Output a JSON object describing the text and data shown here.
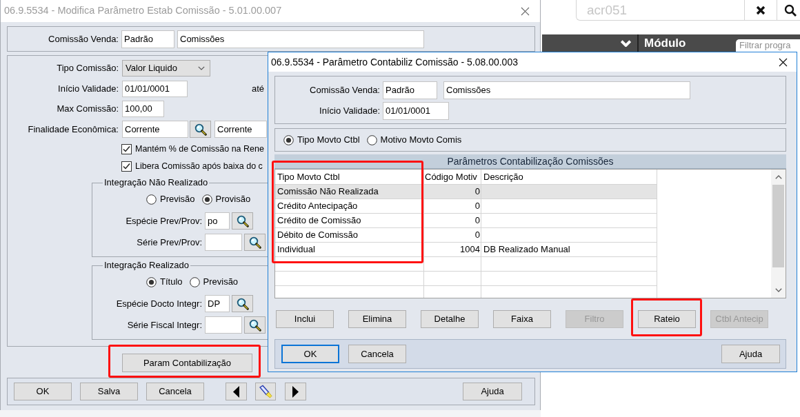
{
  "main_dialog": {
    "title": "06.9.5534 - Modifica Parâmetro Estab Comissão - 5.01.00.007",
    "active": false,
    "commission": {
      "label": "Comissão Venda:",
      "code": "Padrão",
      "name": "Comissões"
    },
    "commission_type": {
      "label": "Tipo Comissão:",
      "value": "Valor Liquido"
    },
    "valid_from": {
      "label": "Início Validade:",
      "value": "01/01/0001",
      "until_label": "até"
    },
    "max_commission": {
      "label": "Max Comissão:",
      "value": "100,00"
    },
    "economic_purpose": {
      "label": "Finalidade Econômica:",
      "code": "Corrente",
      "description": "Corrente"
    },
    "checkboxes": [
      {
        "label": "Mantém % de Comissão na Rene",
        "checked": true
      },
      {
        "label": "Libera Comissão após baixa do c",
        "checked": true
      }
    ],
    "groups": [
      {
        "title": "Integração Não Realizado",
        "options": [
          {
            "label": "Previsão",
            "selected": false
          },
          {
            "label": "Provisão",
            "selected": true
          }
        ],
        "fields": [
          {
            "label": "Espécie Prev/Prov:",
            "value": "po"
          },
          {
            "label": "Série Prev/Prov:"
          }
        ]
      },
      {
        "title": "Integração Realizado",
        "options": [
          {
            "label": "Título",
            "selected": true
          },
          {
            "label": "Previsão",
            "selected": false
          }
        ],
        "fields": [
          {
            "label": "Espécie Docto Integr:",
            "value": "DP"
          },
          {
            "label": "Série Fiscal Integr:"
          }
        ]
      }
    ],
    "param_button": {
      "label": "Param Contabilização",
      "highlighted": true
    },
    "footer_buttons": [
      {
        "label": "OK"
      },
      {
        "label": "Salva"
      },
      {
        "label": "Cancela"
      }
    ],
    "help_button": "Ajuda"
  },
  "background_app": {
    "search": {
      "placeholder": "acr051"
    },
    "module_label": "Módulo",
    "filter": {
      "placeholder": "Filtrar progra"
    }
  },
  "accounting_dialog": {
    "title": "06.9.5534 - Parâmetro Contabiliz Comissão - 5.08.00.003",
    "active": true,
    "commission": {
      "label": "Comissão Venda:",
      "code": "Padrão",
      "name": "Comissões"
    },
    "valid_from": {
      "label": "Início Validade:",
      "value": "01/01/0001"
    },
    "view_options": [
      {
        "label": "Tipo Movto Ctbl",
        "selected": true
      },
      {
        "label": "Motivo Movto Comis",
        "selected": false
      }
    ],
    "table": {
      "title": "Parâmetros Contabilização Comissões",
      "columns": [
        {
          "label": "Tipo Movto Ctbl",
          "highlighted": true
        },
        {
          "label": "Código Motiv",
          "highlighted": false
        },
        {
          "label": "Descrição",
          "highlighted": false
        }
      ],
      "rows": [
        {
          "type": "Comissão Não Realizada",
          "code": "0",
          "selected": true
        },
        {
          "type": "Crédito Antecipação",
          "code": "0",
          "selected": false
        },
        {
          "type": "Crédito de Comissão",
          "code": "0",
          "selected": false
        },
        {
          "type": "Débito de Comissão",
          "code": "0",
          "selected": false
        },
        {
          "type": "Individual",
          "code": "1004",
          "description": "DB Realizado Manual",
          "selected": false
        }
      ]
    },
    "action_buttons": [
      {
        "label": "Inclui",
        "disabled": false,
        "highlighted": false
      },
      {
        "label": "Elimina",
        "disabled": false,
        "highlighted": false
      },
      {
        "label": "Detalhe",
        "disabled": false,
        "highlighted": false
      },
      {
        "label": "Faixa",
        "disabled": false,
        "highlighted": false
      },
      {
        "label": "Filtro",
        "disabled": true,
        "highlighted": false
      },
      {
        "label": "Rateio",
        "disabled": false,
        "highlighted": true
      },
      {
        "label": "Ctbl Antecip",
        "disabled": true,
        "highlighted": false
      }
    ],
    "footer_buttons": [
      {
        "label": "OK",
        "focused": true
      },
      {
        "label": "Cancela",
        "focused": false
      }
    ],
    "help_button": "Ajuda"
  }
}
